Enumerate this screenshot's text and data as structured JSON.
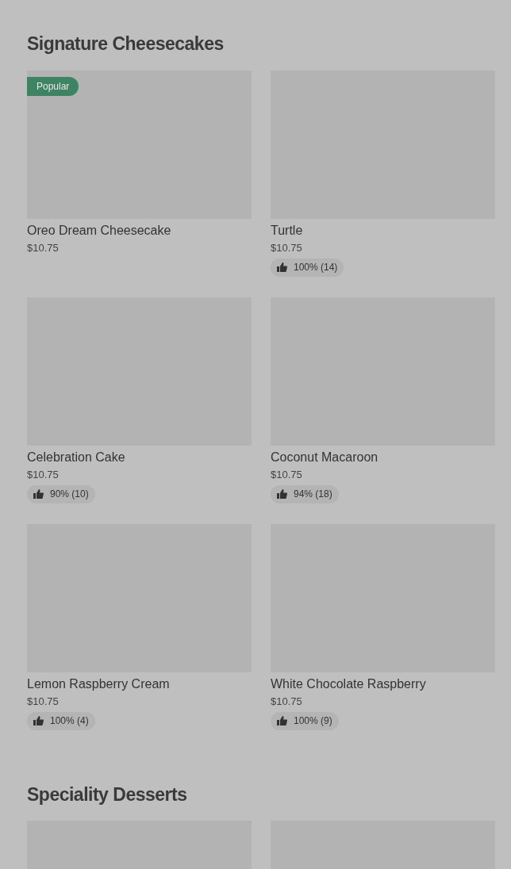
{
  "sections": [
    {
      "title": "Signature Cheesecakes",
      "items": [
        {
          "name": "Oreo Dream Cheesecake",
          "price": "$10.75",
          "badge": "Popular"
        },
        {
          "name": "Turtle",
          "price": "$10.75",
          "rating": "100% (14)"
        },
        {
          "name": "Celebration Cake",
          "price": "$10.75",
          "rating": "90% (10)"
        },
        {
          "name": "Coconut Macaroon",
          "price": "$10.75",
          "rating": "94% (18)"
        },
        {
          "name": "Lemon Raspberry Cream",
          "price": "$10.75",
          "rating": "100% (4)"
        },
        {
          "name": "White Chocolate Raspberry",
          "price": "$10.75",
          "rating": "100% (9)"
        }
      ]
    },
    {
      "title": "Speciality Desserts"
    }
  ]
}
